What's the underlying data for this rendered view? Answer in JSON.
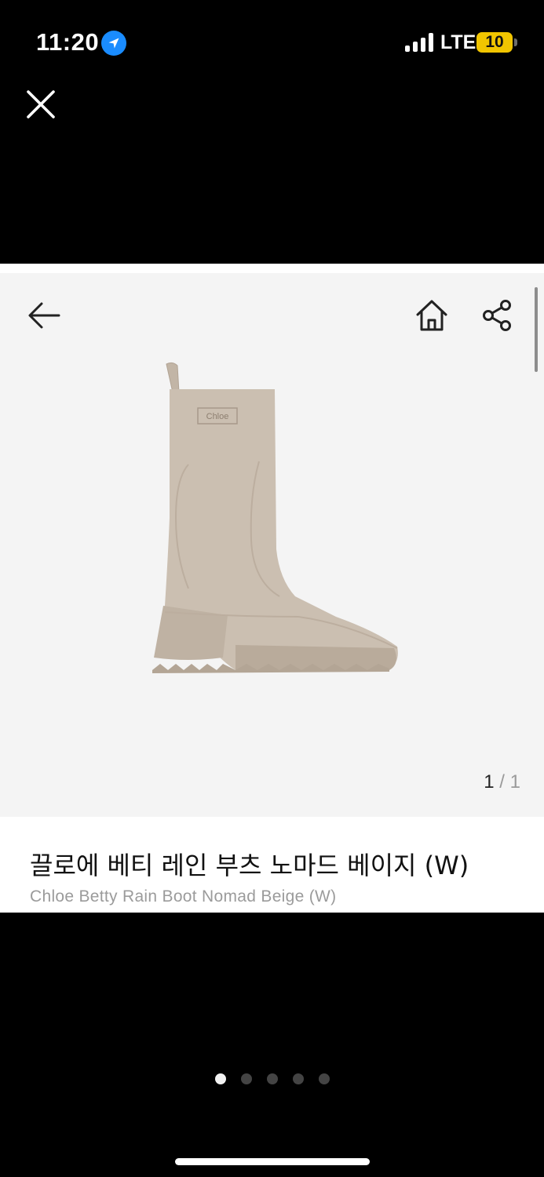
{
  "status_bar": {
    "time": "11:20",
    "network": "LTE",
    "battery": "10",
    "location_icon": "location-arrow-icon",
    "battery_color": "#f1c500"
  },
  "viewer": {
    "close_icon": "close-icon",
    "dots_total": 5,
    "active_dot": 1
  },
  "product": {
    "nav": {
      "back_icon": "arrow-left-icon",
      "home_icon": "home-icon",
      "share_icon": "share-icon"
    },
    "image_counter": {
      "current": "1",
      "separator": "/",
      "total": "1"
    },
    "title_ko": "끌로에 베티 레인 부츠 노마드 베이지 (W)",
    "title_en": "Chloe Betty Rain Boot Nomad Beige (W)",
    "boot_logo_text": "Chloe",
    "boot_color": "#cbbfb1"
  }
}
